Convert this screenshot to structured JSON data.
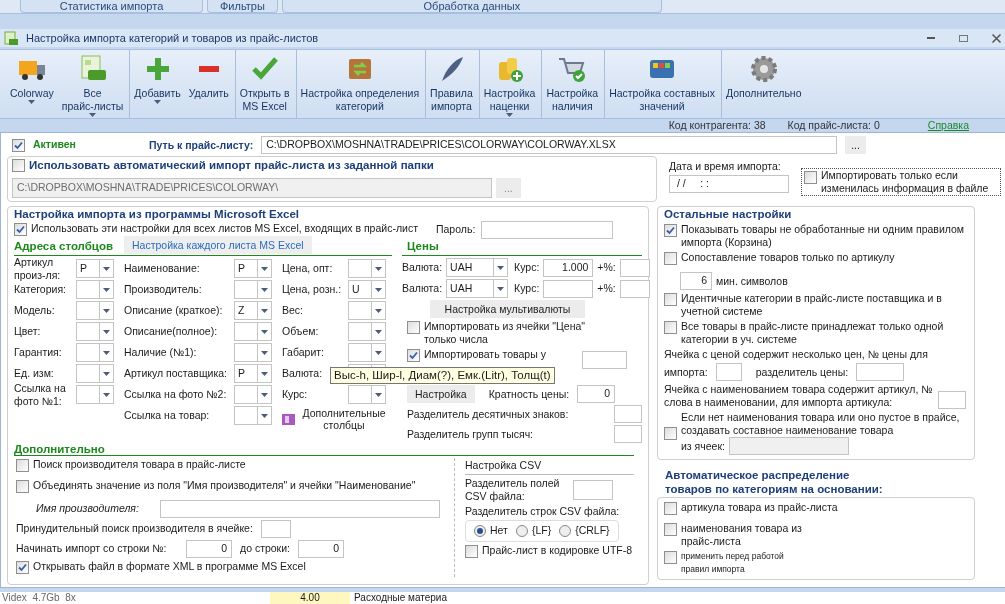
{
  "background_tabs": [
    {
      "label": "Статистика импорта"
    },
    {
      "label": "Фильтры"
    },
    {
      "label": "Обработка данных"
    }
  ],
  "window": {
    "title": "Настройка импорта категорий и товаров из прайс-листов"
  },
  "toolbar": [
    {
      "kind": "truck",
      "lines": [
        "Colorway"
      ],
      "menu": true,
      "separator_before": false
    },
    {
      "kind": "excel",
      "lines": [
        "Все",
        "прайс-листы"
      ],
      "menu": true,
      "separator_before": false
    },
    {
      "kind": "plus",
      "lines": [
        "Добавить"
      ],
      "menu": true,
      "separator_before": true
    },
    {
      "kind": "minus",
      "lines": [
        "Удалить"
      ],
      "menu": false,
      "separator_before": false
    },
    {
      "kind": "check",
      "lines": [
        "Открыть в",
        "MS Excel"
      ],
      "menu": false,
      "separator_before": true
    },
    {
      "kind": "box",
      "lines": [
        "Настройка определения",
        "категорий"
      ],
      "menu": false,
      "separator_before": true
    },
    {
      "kind": "feather",
      "lines": [
        "Правила",
        "импорта"
      ],
      "menu": false,
      "separator_before": true
    },
    {
      "kind": "coins",
      "lines": [
        "Настройка",
        "наценки"
      ],
      "menu": true,
      "separator_before": true
    },
    {
      "kind": "cart",
      "lines": [
        "Настройка",
        "наличия"
      ],
      "menu": false,
      "separator_before": true
    },
    {
      "kind": "palette",
      "lines": [
        "Настройка составных",
        "значений"
      ],
      "menu": false,
      "separator_before": true
    },
    {
      "kind": "gear",
      "lines": [
        "Дополнительно"
      ],
      "menu": false,
      "separator_before": true
    }
  ],
  "status": {
    "contractor": "Код контрагента: 38",
    "price_list": "Код прайс-листа: 0",
    "help": "Справка"
  },
  "main": {
    "active": {
      "label": "Активен",
      "checked": true
    },
    "path_label": "Путь к прайс-листу:",
    "path": "C:\\DROPBOX\\MOSHNA\\TRADE\\PRICES\\COLORWAY\\COLORWAY.XLSX",
    "browse": "..."
  },
  "auto_import": {
    "label": "Использовать автоматический импорт прайс-листа из заданной папки",
    "checked": false,
    "folder": "C:\\DROPBOX\\MOSHNA\\TRADE\\PRICES\\COLORWAY\\",
    "browse": "...",
    "date_label": "Дата и время импорта:",
    "date_value": " / /     : :",
    "only_changed": {
      "label": "Импортировать только если изменилась информация в файле",
      "checked": false
    }
  },
  "excel": {
    "title": "Настройка импорта из программы Microsoft Excel",
    "all_sheets": {
      "label": "Использовать эти настройки для всех листов MS Excel, входящих в прайс-лист",
      "checked": true
    },
    "password_label": "Пароль:",
    "columns_title": "Адреса столбцов",
    "per_sheet_button": "Настройка каждого листа MS Excel",
    "column_groups": [
      [
        {
          "label": "Артикул произ-ля:",
          "value": "P"
        },
        {
          "label": "Категория:"
        },
        {
          "label": "Модель:"
        },
        {
          "label": "Цвет:"
        },
        {
          "label": "Гарантия:"
        },
        {
          "label": "Ед. изм:"
        },
        {
          "label": "Ссылка на фото №1:"
        }
      ],
      [
        {
          "label": "Наименование:",
          "value": "P"
        },
        {
          "label": "Производитель:"
        },
        {
          "label": "Описание (краткое):",
          "value": "Z"
        },
        {
          "label": "Описание(полное):"
        },
        {
          "label": "Наличие (№1):"
        },
        {
          "label": "Артикул поставщика:",
          "value": "P"
        },
        {
          "label": "Ссылка на фото №2:"
        },
        {
          "label": "Ссылка на товар:"
        }
      ],
      [
        {
          "label": "Цена, опт:"
        },
        {
          "label": "Цена, розн.:",
          "value": "U"
        },
        {
          "label": "Вес:"
        },
        {
          "label": "Объем:"
        },
        {
          "label": "Габарит:"
        },
        {
          "label": "Валюта:"
        },
        {
          "label": "Курс:"
        }
      ]
    ],
    "extra_columns": "Дополнительные столбцы",
    "prices": {
      "title": "Цены",
      "rows": [
        {
          "currency_label": "Валюта:",
          "currency": "UAH",
          "rate_label": "Курс:",
          "rate": "1.000",
          "percent_label": "+%:"
        },
        {
          "currency_label": "Валюта:",
          "currency": "UAH",
          "rate_label": "Курс:",
          "percent_label": "+%:"
        }
      ],
      "multicurrency_button": "Настройка мультивалюты",
      "numbers_only": {
        "label": "Импортировать из ячейки \"Цена\" только числа",
        "checked": false
      },
      "min_price": {
        "label": "Импортировать товары у",
        "checked": true
      },
      "setup_button": "Настройка",
      "multiplicity_label": "Кратность цены:",
      "multiplicity": "0",
      "decimal_label": "Разделитель десятичных знаков:",
      "thousands_label": "Разделитель групп тысяч:"
    },
    "extra": {
      "title": "Дополнительно",
      "search_maker": {
        "label": "Поиск производителя товара в прайс-листе",
        "checked": false
      },
      "merge": {
        "label": "Объединять значение из поля \"Имя производителя\" и ячейки \"Наименование\"",
        "checked": false
      },
      "maker_name_label": "Имя производителя:",
      "forced_search_label": "Принудительный поиск производителя в ячейке:",
      "start_label": "Начинать импорт со строки №:",
      "start": "0",
      "end_label": "до строки:",
      "end": "0",
      "open_xml": {
        "label": "Открывать файл в формате XML в программе MS Excel",
        "checked": true
      }
    },
    "csv": {
      "title": "Настройка CSV",
      "field_sep_label": "Разделитель полей CSV файла:",
      "line_sep_label": "Разделитель строк CSV файла:",
      "line_sep": [
        {
          "label": "Нет",
          "selected": true
        },
        {
          "label": "{LF}",
          "selected": false
        },
        {
          "label": "{CRLF}",
          "selected": false
        }
      ],
      "utf8": {
        "label": "Прайс-лист в кодировке UTF-8",
        "checked": false
      }
    },
    "tooltip": "Выс-h, Шир-l, Диам(?), Емк.(Litr), Толщ(t)"
  },
  "other": {
    "title": "Остальные настройки",
    "show_unprocessed": {
      "label": "Показывать товары не обработанные ни одним правилом импорта (Корзина)",
      "checked": true
    },
    "match_by_sku": {
      "label": "Сопоставление товаров только по артикулу",
      "checked": false
    },
    "min_chars": "6",
    "min_chars_label": "мин. символов",
    "identical_categories": {
      "label": "Идентичные категории в прайс-листе поставщика и в учетной системе",
      "checked": false
    },
    "single_category": {
      "label": "Все товары в прайс-листе принадлежат только одной категории в уч. системе",
      "checked": false
    },
    "multi_price_lines": [
      "Ячейка с ценой содержит несколько цен, № цены для",
      "импорта:"
    ],
    "price_sep_label": "разделитель цены:",
    "sku_in_name_label": "Ячейка с наименованием товара содержит артикул, № слова в наименовании, для импорта артикула:",
    "compose_name": {
      "lines": [
        "Если нет наименования товара или оно пустое в прайсе, создавать составное наименование товара",
        "из ячеек:"
      ],
      "checked": false
    }
  },
  "auto_distribution": {
    "title": "Автоматическое распределение товаров по категориям на основании:",
    "options": [
      {
        "label": "артикула товара из прайс-листа",
        "checked": false
      },
      {
        "label": "наименования товара из прайс-листа",
        "checked": false
      },
      {
        "label": "применить перед работой правил импорта",
        "checked": false
      }
    ]
  },
  "background_row": [
    "Videx  4.7Gb  8x",
    "4.00",
    "Расходные материа"
  ]
}
